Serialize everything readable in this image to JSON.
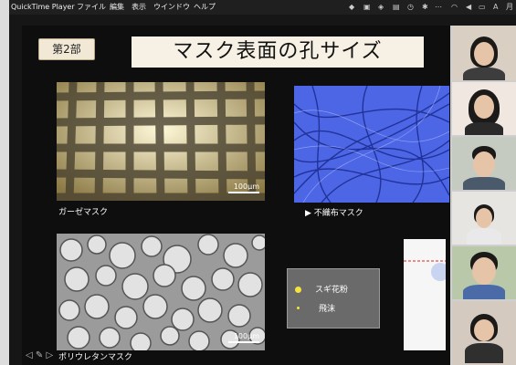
{
  "menubar": {
    "app": "QuickTime Player",
    "items": [
      "ファイル",
      "編集",
      "表示",
      "ウインドウ",
      "ヘルプ"
    ],
    "clock": "月"
  },
  "slide": {
    "section": "第2部",
    "title": "マスク表面の孔サイズ",
    "panels": [
      {
        "caption": "ガーゼマスク",
        "scale": "100μm"
      },
      {
        "caption": "不織布マスク"
      },
      {
        "caption": "ポリウレタンマスク",
        "scale": "100μm"
      }
    ],
    "legend": [
      {
        "label": "スギ花粉",
        "icon": "large-yellow-dot"
      },
      {
        "label": "飛沫",
        "icon": "small-yellow-dot"
      }
    ]
  },
  "colors": {
    "legend_dot": "#f5e43a",
    "nonwoven_bg": "#3a55d8",
    "title_bg": "#f6f1e4"
  }
}
